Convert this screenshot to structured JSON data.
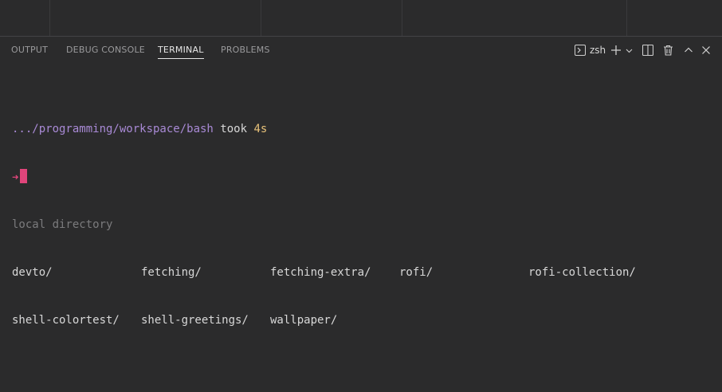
{
  "panel": {
    "tabs": [
      {
        "label": "OUTPUT"
      },
      {
        "label": "DEBUG CONSOLE"
      },
      {
        "label": "TERMINAL"
      },
      {
        "label": "PROBLEMS"
      }
    ],
    "active_tab": "TERMINAL",
    "shell_name": "zsh"
  },
  "terminal": {
    "prompt_path": ".../programming/workspace/bash",
    "took_label": "took",
    "duration": "4s",
    "prompt_symbol": "➜",
    "comment": "local directory",
    "rows": [
      [
        "devto/",
        "fetching/",
        "fetching-extra/",
        "rofi/",
        "rofi-collection/"
      ],
      [
        "shell-colortest/",
        "shell-greetings/",
        "wallpaper/"
      ]
    ]
  },
  "colors": {
    "background": "#2b2b2c",
    "path": "#a98ad6",
    "duration": "#e8c27a",
    "prompt": "#e0457b",
    "comment": "#7b7b7d"
  },
  "icons": [
    "terminal-icon",
    "plus-icon",
    "chevron-down-icon",
    "split-icon",
    "trash-icon",
    "chevron-up-icon",
    "close-icon"
  ]
}
